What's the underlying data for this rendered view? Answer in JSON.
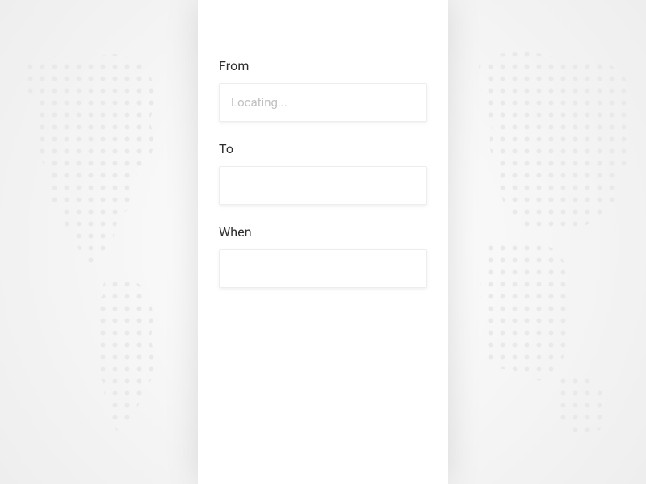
{
  "form": {
    "from": {
      "label": "From",
      "placeholder": "Locating...",
      "value": ""
    },
    "to": {
      "label": "To",
      "placeholder": "",
      "value": ""
    },
    "when": {
      "label": "When",
      "placeholder": "",
      "value": ""
    }
  }
}
